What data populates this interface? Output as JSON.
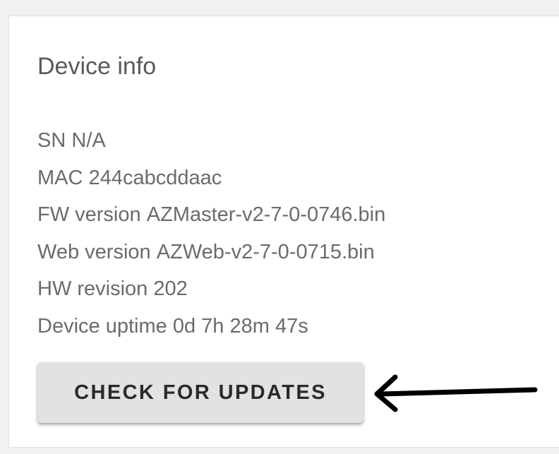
{
  "card": {
    "title": "Device info",
    "items": [
      {
        "label": "SN",
        "value": "N/A"
      },
      {
        "label": "MAC",
        "value": "244cabcddaac"
      },
      {
        "label": "FW version",
        "value": "AZMaster-v2-7-0-0746.bin"
      },
      {
        "label": "Web version",
        "value": "AZWeb-v2-7-0-0715.bin"
      },
      {
        "label": "HW revision",
        "value": "202"
      },
      {
        "label": "Device uptime",
        "value": "0d 7h 28m 47s"
      }
    ],
    "button_label": "CHECK FOR UPDATES"
  },
  "annotation": {
    "icon": "arrow-left-icon",
    "color": "#000000"
  },
  "colors": {
    "background": "#f1f1f1",
    "card": "#ffffff",
    "text": "#6b6b6b",
    "button": "#e2e2e2"
  }
}
